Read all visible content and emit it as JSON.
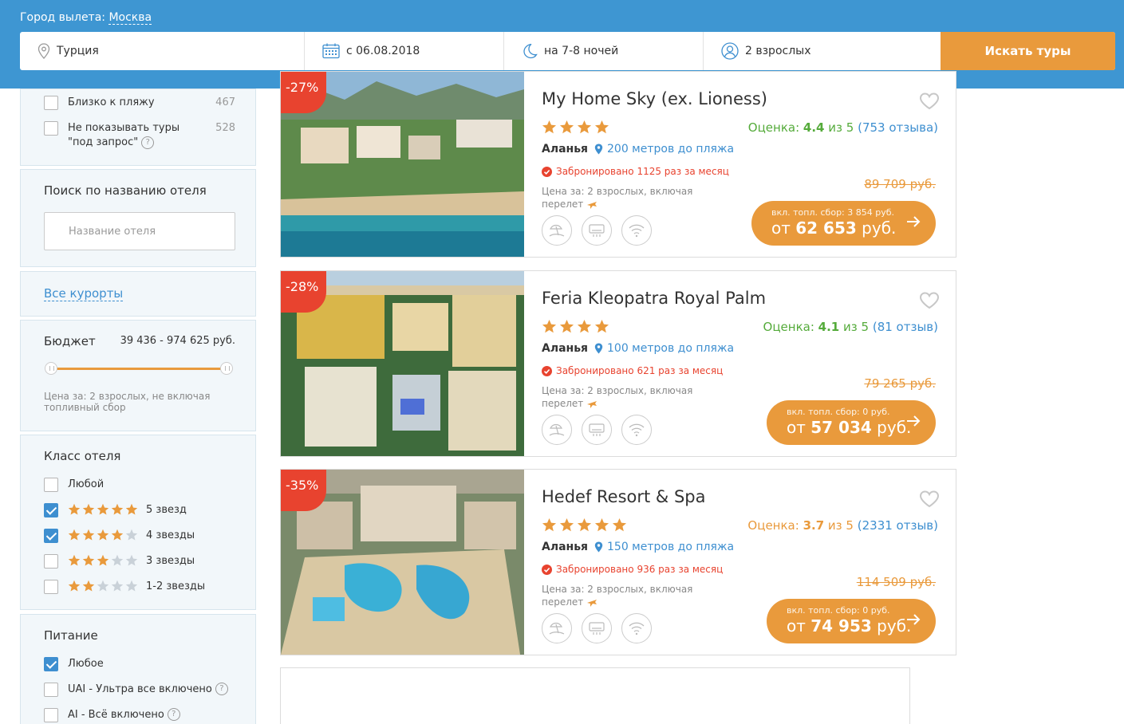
{
  "header": {
    "city_label": "Город вылета:",
    "city_value": "Москва",
    "country": "Турция",
    "date": "с 06.08.2018",
    "nights": "на 7-8 ночей",
    "people": "2 взрослых",
    "search_button": "Искать туры"
  },
  "filters": {
    "beach": {
      "label": "Близко к пляжу",
      "count": "467"
    },
    "no_request": {
      "label_line1": "Не показывать туры",
      "label_line2": "\"под запрос\"",
      "count": "528"
    },
    "hotel_search": {
      "title": "Поиск по названию отеля",
      "placeholder": "Название отеля"
    },
    "resorts_link": "Все курорты",
    "budget": {
      "title": "Бюджет",
      "range": "39 436 - 974 625 руб.",
      "note": "Цена за: 2 взрослых, не включая топливный сбор"
    },
    "hotel_class": {
      "title": "Класс отеля",
      "items": [
        {
          "label": "Любой",
          "checked": false,
          "stars": 0
        },
        {
          "label": "5 звезд",
          "checked": true,
          "stars": 5
        },
        {
          "label": "4 звезды",
          "checked": true,
          "stars": 4
        },
        {
          "label": "3 звезды",
          "checked": false,
          "stars": 3
        },
        {
          "label": "1-2 звезды",
          "checked": false,
          "stars": 2
        }
      ]
    },
    "meals": {
      "title": "Питание",
      "items": [
        {
          "label": "Любое",
          "checked": true
        },
        {
          "label": "UAI - Ультра все включено",
          "checked": false
        },
        {
          "label": "AI - Всё включено",
          "checked": false
        }
      ]
    }
  },
  "hotels": [
    {
      "discount": "-27%",
      "name": "My Home Sky (ex. Lioness)",
      "stars": 4,
      "rating_label": "Оценка:",
      "rating_value": "4.4",
      "rating_scale": "из 5",
      "reviews": "753 отзыва",
      "rating_color": "#55ab3b",
      "region": "Аланья",
      "distance": "200 метров до пляжа",
      "booked": "Забронировано 1125 раз за месяц",
      "price_for_line1": "Цена за: 2 взрослых, включая",
      "price_for_line2": "перелет",
      "old_price": "89 709 руб.",
      "fee": "вкл. топл. сбор: 3 854 руб.",
      "price_prefix": "от",
      "price": "62 653",
      "currency": "руб."
    },
    {
      "discount": "-28%",
      "name": "Feria Kleopatra Royal Palm",
      "stars": 4,
      "rating_label": "Оценка:",
      "rating_value": "4.1",
      "rating_scale": "из 5",
      "reviews": "81 отзыв",
      "rating_color": "#55ab3b",
      "region": "Аланья",
      "distance": "100 метров до пляжа",
      "booked": "Забронировано 621 раз за месяц",
      "price_for_line1": "Цена за: 2 взрослых, включая",
      "price_for_line2": "перелет",
      "old_price": "79 265 руб.",
      "fee": "вкл. топл. сбор: 0 руб.",
      "price_prefix": "от",
      "price": "57 034",
      "currency": "руб."
    },
    {
      "discount": "-35%",
      "name": "Hedef Resort & Spa",
      "stars": 5,
      "rating_label": "Оценка:",
      "rating_value": "3.7",
      "rating_scale": "из 5",
      "reviews": "2331 отзыв",
      "rating_color": "#e99a3c",
      "region": "Аланья",
      "distance": "150 метров до пляжа",
      "booked": "Забронировано 936 раз за месяц",
      "price_for_line1": "Цена за: 2 взрослых, включая",
      "price_for_line2": "перелет",
      "old_price": "114 509 руб.",
      "fee": "вкл. топл. сбор: 0 руб.",
      "price_prefix": "от",
      "price": "74 953",
      "currency": "руб."
    }
  ],
  "colors": {
    "header_blue": "#3e96d2",
    "accent_orange": "#e99a3c",
    "discount_red": "#e8432f",
    "link_blue": "#3e8fd0"
  }
}
